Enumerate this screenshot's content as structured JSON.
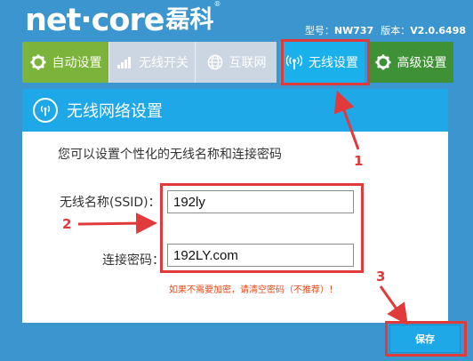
{
  "brand": {
    "latin": "net·core",
    "cjk": "磊科",
    "reg": "®"
  },
  "model": {
    "model_label": "型号：",
    "model_value": "NW737",
    "version_label": "版本：",
    "version_value": "V2.0.6498"
  },
  "tabs": [
    {
      "label": "自动设置",
      "icon": "gear-icon"
    },
    {
      "label": "无线开关",
      "icon": "signal-bars-icon"
    },
    {
      "label": "互联网",
      "icon": "globe-icon"
    },
    {
      "label": "无线设置",
      "icon": "wireless-icon"
    },
    {
      "label": "高级设置",
      "icon": "gear-icon"
    }
  ],
  "panel": {
    "title": "无线网络设置",
    "intro": "您可以设置个性化的无线名称和连接密码",
    "ssid_label": "无线名称(SSID)：",
    "ssid_value": "192ly",
    "password_label": "连接密码：",
    "password_value": "192LY.com",
    "hint": "如果不需要加密，请清空密码（不推荐）！"
  },
  "save_label": "保存",
  "annotations": [
    "1",
    "2",
    "3"
  ],
  "colors": {
    "background": "#3b95cf",
    "active_tab": "#19b0eb",
    "accent_red": "#e03a3a",
    "hint_text": "#e64a19"
  }
}
